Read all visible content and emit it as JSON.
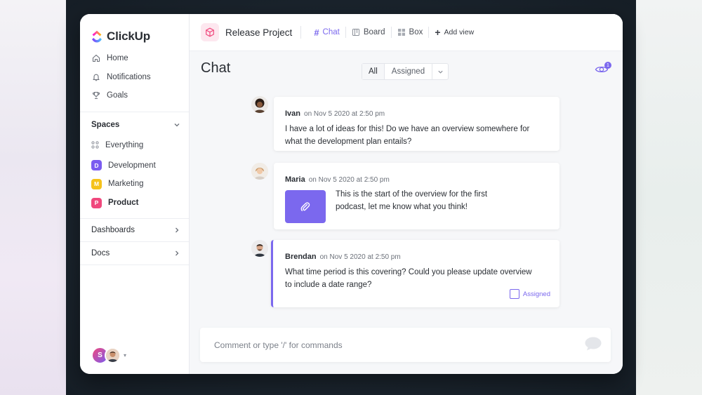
{
  "app": {
    "name": "ClickUp"
  },
  "sidebar": {
    "nav": [
      {
        "label": "Home",
        "icon": "home-icon"
      },
      {
        "label": "Notifications",
        "icon": "bell-icon"
      },
      {
        "label": "Goals",
        "icon": "trophy-icon"
      }
    ],
    "spaces_label": "Spaces",
    "spaces": [
      {
        "label": "Everything",
        "icon": "grid-icon"
      },
      {
        "label": "Development",
        "badge": "D",
        "color": "#7b5cf0"
      },
      {
        "label": "Marketing",
        "badge": "M",
        "color": "#f5c21b"
      },
      {
        "label": "Product",
        "badge": "P",
        "color": "#f0487d"
      }
    ],
    "dashboards_label": "Dashboards",
    "docs_label": "Docs",
    "user_initial": "S"
  },
  "header": {
    "project": "Release Project",
    "tabs": [
      {
        "label": "Chat",
        "active": true
      },
      {
        "label": "Board"
      },
      {
        "label": "Box"
      }
    ],
    "add_view": "Add view"
  },
  "main": {
    "title": "Chat",
    "filter": {
      "all": "All",
      "assigned": "Assigned"
    },
    "watchers_count": "1"
  },
  "messages": [
    {
      "name": "Ivan",
      "time": "on Nov 5 2020 at 2:50 pm",
      "text": "I have a lot of ideas for this! Do we have an overview somewhere for what the development plan entails?"
    },
    {
      "name": "Maria",
      "time": "on Nov 5 2020 at 2:50 pm",
      "text": "This is the start of the overview for the first podcast, let me know what you think!"
    },
    {
      "name": "Brendan",
      "time": "on Nov 5 2020 at 2:50 pm",
      "text": "What time period is this covering? Could you please update overview to include a date range?",
      "tag": "Assigned"
    }
  ],
  "composer": {
    "placeholder": "Comment or type '/' for commands"
  },
  "colors": {
    "accent": "#7b68ee",
    "brand_pink": "#f0487d"
  }
}
